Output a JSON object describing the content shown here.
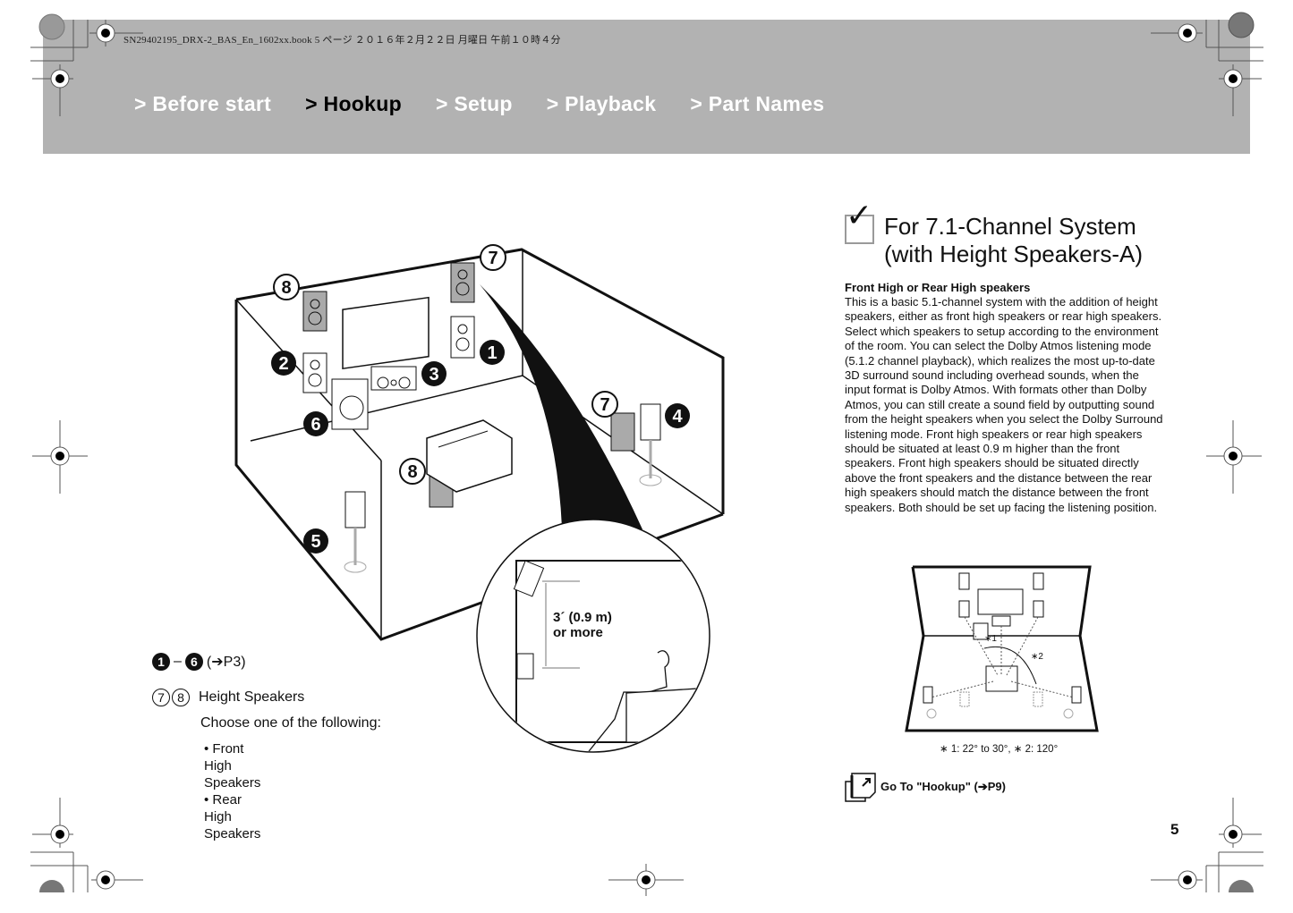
{
  "header": {
    "file_info": "SN29402195_DRX-2_BAS_En_1602xx.book  5 ページ  ２０１６年２月２２日  月曜日  午前１０時４分",
    "nav_tabs": [
      {
        "label": "> Before start",
        "active": false
      },
      {
        "label": "> Hookup",
        "active": true
      },
      {
        "label": "> Setup",
        "active": false
      },
      {
        "label": "> Playback",
        "active": false
      },
      {
        "label": "> Part Names",
        "active": false
      }
    ]
  },
  "diagram": {
    "callouts": {
      "n1": "1",
      "n2": "2",
      "n3": "3",
      "n4": "4",
      "n5": "5",
      "n6": "6",
      "h7": "7",
      "h8": "8"
    },
    "inset_label_line1": "3´ (0.9 m)",
    "inset_label_line2": "or more"
  },
  "legend": {
    "range_start": "1",
    "range_dash": "–",
    "range_end": "6",
    "range_ref": "(➔P3)",
    "height_num_a": "7",
    "height_num_b": "8",
    "height_label": "Height Speakers",
    "choose_label": "Choose one of the following:",
    "options": [
      "Front High Speakers",
      "Rear High Speakers"
    ]
  },
  "section": {
    "check_icon": "✓",
    "title_line1": "For 7.1-Channel System",
    "title_line2": "(with Height Speakers-A)",
    "subheading": "Front High or Rear High speakers",
    "body": "This is a basic 5.1-channel system with the addition of height speakers, either as front high speakers or rear high speakers. Select which speakers to setup according to the environment of the room. You can select the Dolby Atmos listening mode (5.1.2 channel playback), which realizes the most up-to-date 3D surround sound including overhead sounds, when the input format is Dolby Atmos. With formats other than Dolby Atmos, you can still create a sound field by outputting sound from the height speakers when you select the Dolby Surround listening mode. Front high speakers or rear high speakers should be situated at least 0.9 m higher than the front speakers. Front high speakers should be situated directly above the front speakers and the distance between the rear high speakers should match the distance between the front speakers. Both should be set up facing the listening position.",
    "small_diagram_marks": {
      "mark1": "∗1",
      "mark2": "∗2"
    },
    "angle_caption": "∗ 1: 22° to 30°, ∗ 2: 120°",
    "goto_label": "Go To \"Hookup\" (➔P9)",
    "page_number": "5"
  }
}
